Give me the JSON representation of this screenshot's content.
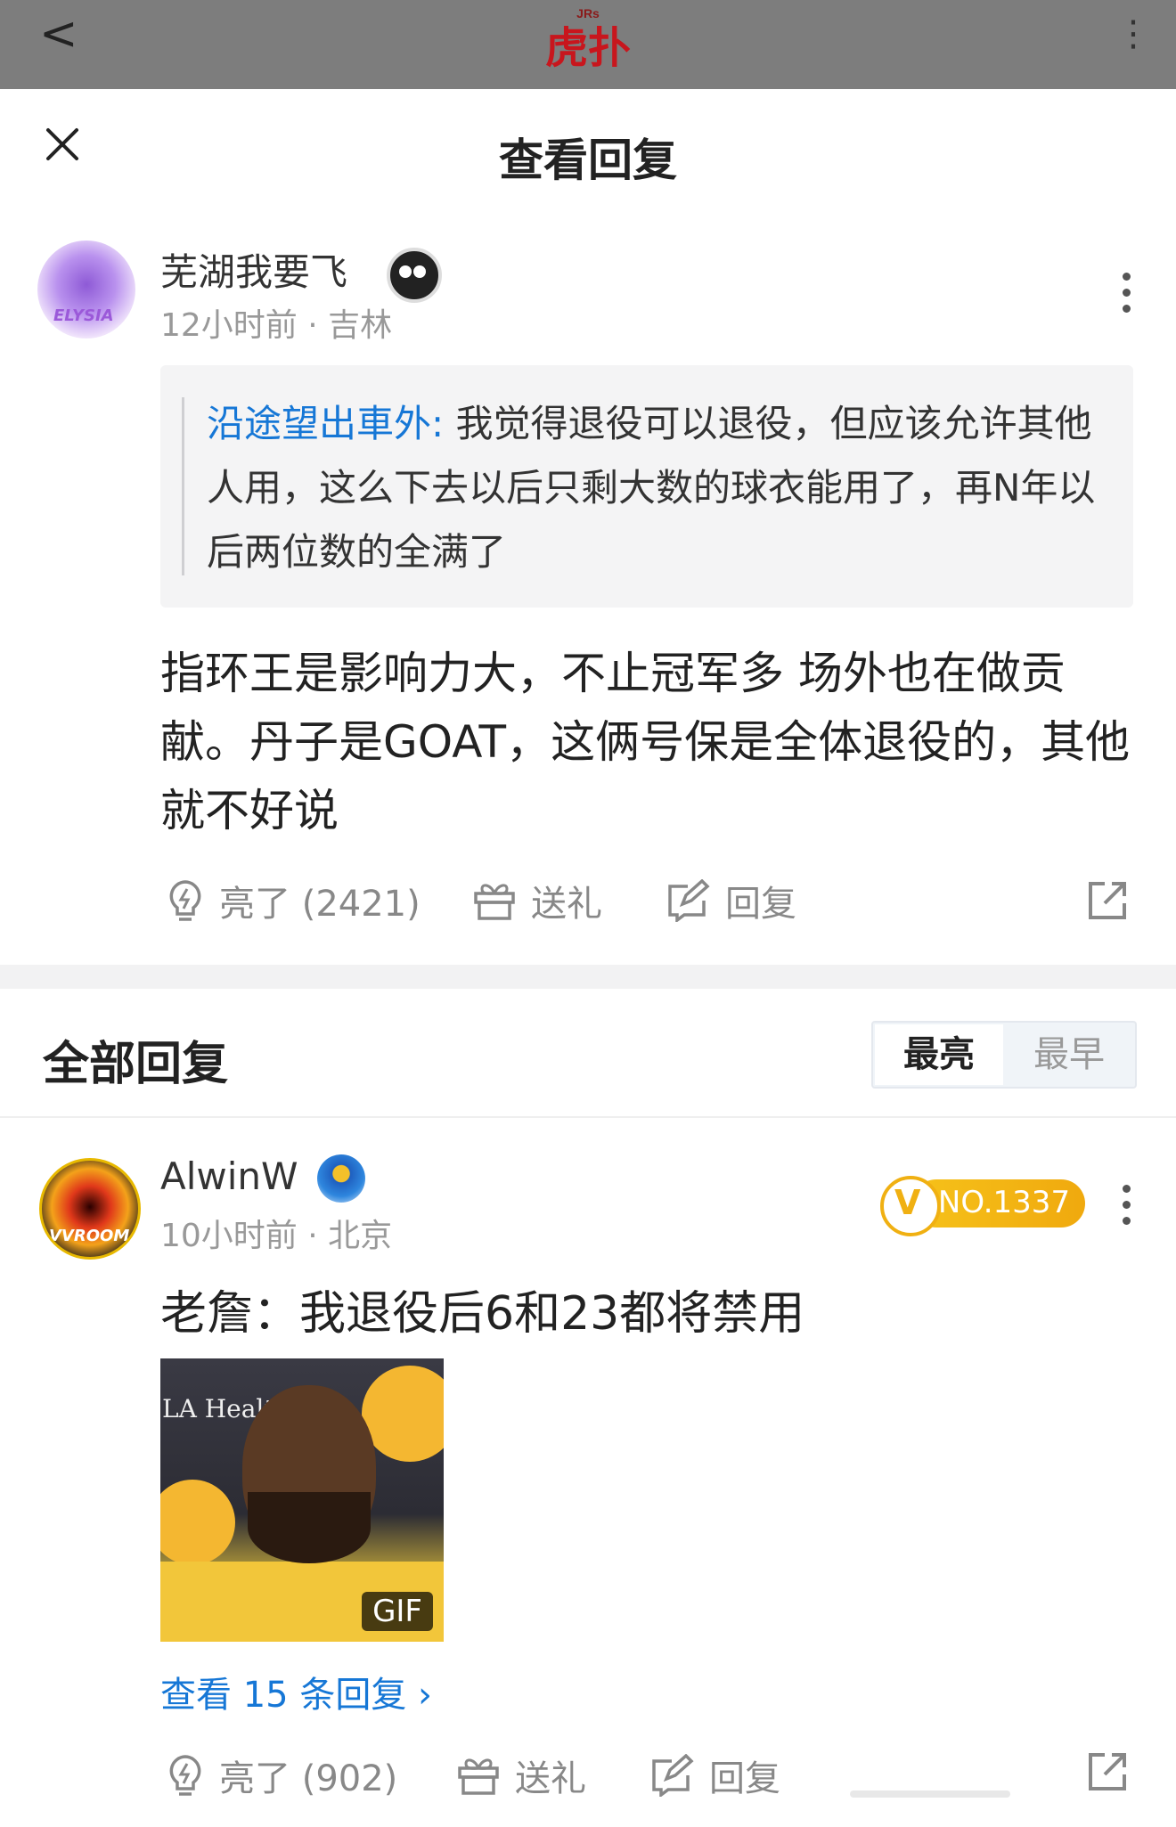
{
  "top_bar": {
    "back_label": "<",
    "logo_text": "虎扑",
    "logo_super": "JRs",
    "more_label": "⋮",
    "logo_color": "#c8161d"
  },
  "sheet": {
    "title": "查看回复"
  },
  "main_comment": {
    "username": "芜湖我要飞",
    "avatar_text": "ELYSIA",
    "time": "12小时前",
    "location": "吉林",
    "quote_author": "沿途望出車外:",
    "quote_text": " 我觉得退役可以退役，但应该允许其他人用，这么下去以后只剩大数的球衣能用了，再N年以后两位数的全满了",
    "body": "指环王是影响力大，不止冠军多 场外也在做贡献。丹子是GOAT，这俩号保是全体退役的，其他就不好说",
    "actions": {
      "like": "亮了 (2421)",
      "gift": "送礼",
      "reply": "回复"
    }
  },
  "all_replies": {
    "title": "全部回复",
    "sort_selected": "最亮",
    "sort_other": "最早"
  },
  "reply": {
    "username": "AlwinW",
    "avatar_text": "VVROOM",
    "time": "10小时前",
    "location": "北京",
    "vip_number": "NO.1337",
    "body": "老詹：我退役后6和23都将禁用",
    "gif": {
      "label": "GIF",
      "caption_text": "LA Healt"
    },
    "view_more": "查看 15 条回复 ›",
    "actions": {
      "like": "亮了 (902)",
      "gift": "送礼",
      "reply": "回复"
    }
  },
  "colors": {
    "link_blue": "#1677d6",
    "vip_gold": "#f3b414",
    "text_gray": "#999999"
  }
}
